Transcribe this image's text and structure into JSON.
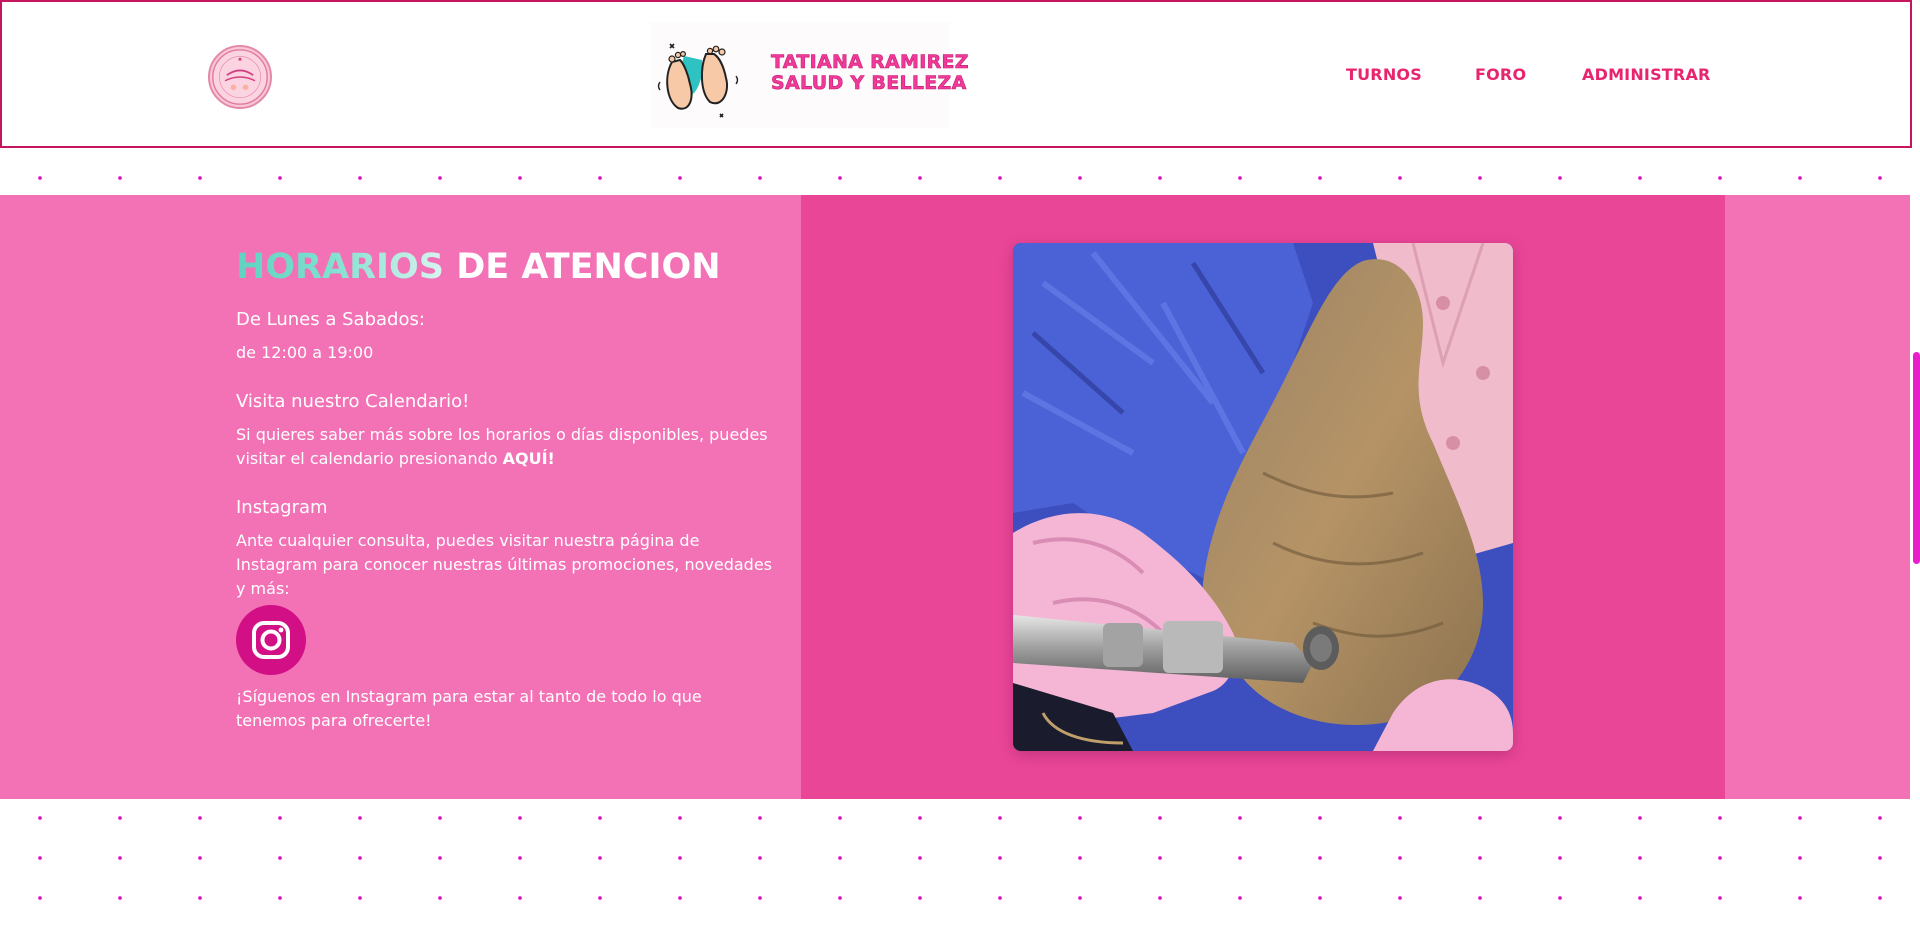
{
  "header": {
    "logo_alt": "Tatiana Ramirez",
    "brand_line1": "TATIANA RAMIREZ",
    "brand_line2": "SALUD Y BELLEZA",
    "nav": [
      {
        "label": "TURNOS"
      },
      {
        "label": "FORO"
      },
      {
        "label": "ADMINISTRAR"
      }
    ]
  },
  "schedule": {
    "title_accent": "HORARIOS",
    "title_rest": " DE ATENCION",
    "days_heading": "De Lunes a Sabados:",
    "hours": "de 12:00 a 19:00",
    "calendar_heading": "Visita nuestro Calendario!",
    "calendar_text": "Si quieres saber más sobre los horarios o días disponibles, puedes visitar el calendario presionando ",
    "calendar_link": "AQUÍ!",
    "instagram_heading": "Instagram",
    "instagram_text": "Ante cualquier consulta, puedes visitar nuestra página de Instagram para conocer nuestras últimas promociones, novedades y más:",
    "instagram_icon": "instagram-icon",
    "follow_text": "¡Síguenos en Instagram para estar al tanto de todo lo que tenemos para ofrecerte!"
  },
  "colors": {
    "band_outer": "#f372b6",
    "band_center": "#ea4698",
    "nav_text": "#e8246f",
    "header_border": "#c5155c",
    "title_accent": "#5ed3c0",
    "dot_pattern": "#e01ac6"
  }
}
